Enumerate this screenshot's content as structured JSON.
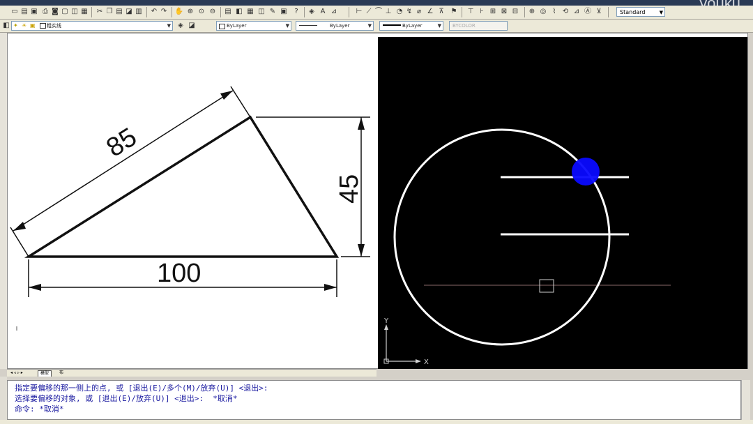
{
  "watermark": "youku",
  "toolbar": {
    "text_style": "Standard"
  },
  "properties": {
    "layer_name": "粗实线",
    "color": "ByLayer",
    "linetype": "ByLayer",
    "lineweight": "ByLayer",
    "plot_style": "BYCOLOR"
  },
  "drawing": {
    "dim_hypotenuse": "85",
    "dim_height": "45",
    "dim_base": "100"
  },
  "viewport": {
    "ucs_y": "Y",
    "ucs_x": "X"
  },
  "tabs": [
    "模型",
    "布"
  ],
  "command": {
    "line1": "指定要偏移的那一侧上的点, 或 [退出(E)/多个(M)/放弃(U)] <退出>:",
    "line2": "选择要偏移的对象, 或 [退出(E)/放弃(U)] <退出>:  *取消*",
    "line3": "命令: *取消*"
  },
  "colors": {
    "command_text": "#1a1aa0",
    "highlight_dot": "#0a0aff"
  }
}
